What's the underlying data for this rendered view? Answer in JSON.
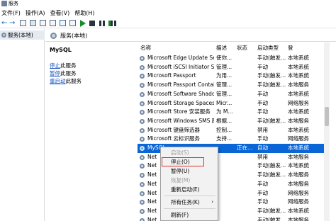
{
  "window": {
    "title": "服务"
  },
  "menu": [
    "文件(F)",
    "操作(A)",
    "查看(V)",
    "帮助(H)"
  ],
  "tree": {
    "root_label": "服务(本地)"
  },
  "content": {
    "header_title": "服务(本地)",
    "selected_service_name": "MySQL",
    "actions": [
      {
        "link": "停止",
        "suffix": "此服务"
      },
      {
        "link": "暂停",
        "suffix": "此服务"
      },
      {
        "link": "重启动",
        "suffix": "此服务"
      }
    ]
  },
  "columns": {
    "name": "名称",
    "desc": "描述",
    "status": "状态",
    "startup": "启动类型",
    "logon": "登"
  },
  "rows": [
    {
      "name": "Microsoft Edge Update Ser...",
      "desc": "使你...",
      "status": "",
      "startup": "手动(触发...",
      "logon": "本地系统"
    },
    {
      "name": "Microsoft iSCSI Initiator Ser...",
      "desc": "管理...",
      "status": "",
      "startup": "手动",
      "logon": "本地系统"
    },
    {
      "name": "Microsoft Passport",
      "desc": "为用...",
      "status": "",
      "startup": "手动(触发...",
      "logon": "本地系统"
    },
    {
      "name": "Microsoft Passport Container",
      "desc": "管理...",
      "status": "",
      "startup": "手动(触发...",
      "logon": "本地服务"
    },
    {
      "name": "Microsoft Software Shado...",
      "desc": "管理...",
      "status": "",
      "startup": "手动",
      "logon": "本地系统"
    },
    {
      "name": "Microsoft Storage Spaces S...",
      "desc": "Micr...",
      "status": "",
      "startup": "手动",
      "logon": "网络服务"
    },
    {
      "name": "Microsoft Store 安装服务",
      "desc": "为 M...",
      "status": "",
      "startup": "手动",
      "logon": "本地系统"
    },
    {
      "name": "Microsoft Windows SMS 路...",
      "desc": "根据...",
      "status": "",
      "startup": "手动(触发...",
      "logon": "本地服务"
    },
    {
      "name": "Microsoft 键盘筛选器",
      "desc": "控制...",
      "status": "",
      "startup": "禁用",
      "logon": "本地系统"
    },
    {
      "name": "Microsoft 云标识服务",
      "desc": "支持...",
      "status": "",
      "startup": "手动",
      "logon": "网络服务"
    },
    {
      "name": "MySQL",
      "desc": "",
      "status": "正在...",
      "startup": "自动",
      "logon": "本地系统",
      "selected": true
    },
    {
      "name": "Net",
      "desc": "",
      "status": "",
      "startup": "禁用",
      "logon": "本地服务"
    },
    {
      "name": "Net",
      "desc": "",
      "status": "",
      "startup": "手动(触发...",
      "logon": "本地系统"
    },
    {
      "name": "Net",
      "desc": "",
      "status": "",
      "startup": "手动(触发...",
      "logon": "本地服务"
    },
    {
      "name": "Net",
      "desc": "",
      "status": "",
      "startup": "手动",
      "logon": "本地服务"
    },
    {
      "name": "Net",
      "desc": "",
      "status": "",
      "startup": "手动",
      "logon": "网络服务"
    },
    {
      "name": "Net",
      "desc": "",
      "status": "",
      "startup": "手动",
      "logon": "网络服务"
    },
    {
      "name": "Net",
      "desc": "",
      "status": "",
      "startup": "手动(触发...",
      "logon": "本地系统"
    },
    {
      "name": "Net",
      "desc": "",
      "status": "",
      "startup": "手动(触发...",
      "logon": "本地服务"
    }
  ],
  "context_menu": {
    "items": [
      {
        "label": "启动(S)",
        "disabled": true
      },
      {
        "label": "停止(O)",
        "disabled": false
      },
      {
        "label": "暂停(U)",
        "disabled": false
      },
      {
        "label": "恢复(M)",
        "disabled": true
      },
      {
        "label": "重新启动(E)",
        "disabled": false
      },
      {
        "label": "所有任务(K)",
        "disabled": false
      },
      {
        "label": "刷新(F)",
        "disabled": false
      }
    ],
    "submenu_arrow": "›"
  },
  "colors": {
    "selection": "#0a66d6",
    "highlight_box": "#e03030",
    "link": "#1a55c4"
  }
}
